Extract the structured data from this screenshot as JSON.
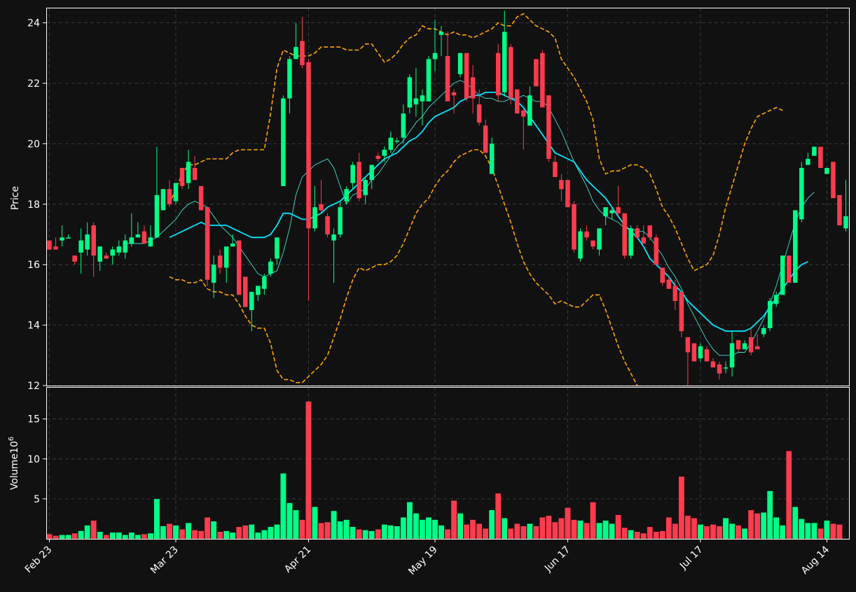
{
  "chart_data": {
    "type": "candlestick",
    "price_panel": {
      "ylabel": "Price",
      "ylim": [
        12,
        24.5
      ],
      "yticks": [
        12,
        14,
        16,
        18,
        20,
        22,
        24
      ]
    },
    "volume_panel": {
      "ylabel": "Volume",
      "ylabel_exponent": "10",
      "ylabel_exponent_power": "6",
      "ylim": [
        0,
        19
      ],
      "yticks": [
        5,
        10,
        15
      ]
    },
    "x_tick_labels": [
      {
        "label": "Feb 23",
        "index": 0
      },
      {
        "label": "Mar 23",
        "index": 20
      },
      {
        "label": "Apr 21",
        "index": 41
      },
      {
        "label": "May 19",
        "index": 61
      },
      {
        "label": "Jun 17",
        "index": 82
      },
      {
        "label": "Jul 17",
        "index": 103
      },
      {
        "label": "Aug 14",
        "index": 123
      }
    ],
    "grid": true,
    "colors": {
      "background": "#111111",
      "up": "#00ff88",
      "down": "#ff3b4e",
      "ma_fast": "#40e0d0",
      "ma_slow": "#00e5ff",
      "bollinger": "#ffa500",
      "grid": "#444444",
      "axis": "#ffffff"
    },
    "candles": [
      [
        16.8,
        16.8,
        16.5,
        16.5
      ],
      [
        16.6,
        16.9,
        16.5,
        16.5
      ],
      [
        16.8,
        17.3,
        16.6,
        16.9
      ],
      [
        16.9,
        17.0,
        16.9,
        16.9
      ],
      [
        16.3,
        16.3,
        16.0,
        16.1
      ],
      [
        16.4,
        17.2,
        15.7,
        16.8
      ],
      [
        16.5,
        17.4,
        16.3,
        17.0
      ],
      [
        17.3,
        17.4,
        15.6,
        16.3
      ],
      [
        16.1,
        16.6,
        15.8,
        16.6
      ],
      [
        16.3,
        16.4,
        16.3,
        16.2
      ],
      [
        16.3,
        16.6,
        16.0,
        16.5
      ],
      [
        16.4,
        16.8,
        16.3,
        16.6
      ],
      [
        16.4,
        17.0,
        16.2,
        16.8
      ],
      [
        16.7,
        17.7,
        16.6,
        16.9
      ],
      [
        16.9,
        17.4,
        16.9,
        17.0
      ],
      [
        17.1,
        17.3,
        16.7,
        16.7
      ],
      [
        16.6,
        17.3,
        16.6,
        16.9
      ],
      [
        16.9,
        19.9,
        16.9,
        18.3
      ],
      [
        17.8,
        18.5,
        17.8,
        18.5
      ],
      [
        18.5,
        18.8,
        17.9,
        18.0
      ],
      [
        18.1,
        18.7,
        18.0,
        18.7
      ],
      [
        19.2,
        19.2,
        18.5,
        18.6
      ],
      [
        18.7,
        19.8,
        18.5,
        19.4
      ],
      [
        19.2,
        19.6,
        18.8,
        18.8
      ],
      [
        18.6,
        18.6,
        17.8,
        17.8
      ],
      [
        17.9,
        17.9,
        15.3,
        15.5
      ],
      [
        15.4,
        16.3,
        14.9,
        16.0
      ],
      [
        16.3,
        16.5,
        15.7,
        15.9
      ],
      [
        15.9,
        16.6,
        15.4,
        16.6
      ],
      [
        16.6,
        17.0,
        16.6,
        16.7
      ],
      [
        16.8,
        16.8,
        15.1,
        15.0
      ],
      [
        15.6,
        15.6,
        14.6,
        14.6
      ],
      [
        14.5,
        15.1,
        13.8,
        15.1
      ],
      [
        15.0,
        15.3,
        14.8,
        15.3
      ],
      [
        15.2,
        15.7,
        15.0,
        15.6
      ],
      [
        15.7,
        16.2,
        15.6,
        16.1
      ],
      [
        16.2,
        16.9,
        16.0,
        16.9
      ],
      [
        18.6,
        21.6,
        18.6,
        21.5
      ],
      [
        21.5,
        22.9,
        21.0,
        22.8
      ],
      [
        22.8,
        24.0,
        22.8,
        23.2
      ],
      [
        23.4,
        24.2,
        22.5,
        22.6
      ],
      [
        22.7,
        22.8,
        14.8,
        17.2
      ],
      [
        17.2,
        18.6,
        17.1,
        17.9
      ],
      [
        18.0,
        18.8,
        17.7,
        17.8
      ],
      [
        17.6,
        17.7,
        16.9,
        17.0
      ],
      [
        16.8,
        17.2,
        15.4,
        17.0
      ],
      [
        17.0,
        18.1,
        16.9,
        17.9
      ],
      [
        18.1,
        18.6,
        18.0,
        18.5
      ],
      [
        18.7,
        19.4,
        18.5,
        19.3
      ],
      [
        19.4,
        19.7,
        18.1,
        18.2
      ],
      [
        18.3,
        18.9,
        18.0,
        18.8
      ],
      [
        18.8,
        19.3,
        18.5,
        19.3
      ],
      [
        19.6,
        19.7,
        19.4,
        19.5
      ],
      [
        19.6,
        19.9,
        19.4,
        19.8
      ],
      [
        19.8,
        20.4,
        19.7,
        20.2
      ],
      [
        20.1,
        20.2,
        20.0,
        20.1
      ],
      [
        20.2,
        21.3,
        20.0,
        21.0
      ],
      [
        21.2,
        22.3,
        21.0,
        22.2
      ],
      [
        21.3,
        22.5,
        20.9,
        21.5
      ],
      [
        21.4,
        21.8,
        20.6,
        21.6
      ],
      [
        21.4,
        22.9,
        21.4,
        22.8
      ],
      [
        22.8,
        24.1,
        22.4,
        23.0
      ],
      [
        23.6,
        23.9,
        22.9,
        23.7
      ],
      [
        22.9,
        23.7,
        22.5,
        21.4
      ],
      [
        21.7,
        21.8,
        21.0,
        21.6
      ],
      [
        22.3,
        23.0,
        22.2,
        23.0
      ],
      [
        23.0,
        23.0,
        21.4,
        21.5
      ],
      [
        22.2,
        22.6,
        21.0,
        21.5
      ],
      [
        21.3,
        21.8,
        20.6,
        20.7
      ],
      [
        20.6,
        20.8,
        19.8,
        19.7
      ],
      [
        19.0,
        20.2,
        19.0,
        20.0
      ],
      [
        23.0,
        23.3,
        21.4,
        21.6
      ],
      [
        21.7,
        24.4,
        21.6,
        23.7
      ],
      [
        23.2,
        23.3,
        21.3,
        21.5
      ],
      [
        21.8,
        21.8,
        21.0,
        21.0
      ],
      [
        21.1,
        21.2,
        19.8,
        20.9
      ],
      [
        20.6,
        21.9,
        20.6,
        21.6
      ],
      [
        22.8,
        22.8,
        21.9,
        21.9
      ],
      [
        23.0,
        23.1,
        21.3,
        21.2
      ],
      [
        21.6,
        21.6,
        19.4,
        19.5
      ],
      [
        19.4,
        19.6,
        18.9,
        18.9
      ],
      [
        18.8,
        19.0,
        18.1,
        18.5
      ],
      [
        18.8,
        18.8,
        17.9,
        17.9
      ],
      [
        18.0,
        18.1,
        16.4,
        16.5
      ],
      [
        16.2,
        17.2,
        16.1,
        17.1
      ],
      [
        17.1,
        17.3,
        16.8,
        16.9
      ],
      [
        16.8,
        16.8,
        16.5,
        16.6
      ],
      [
        16.5,
        17.2,
        16.3,
        17.2
      ],
      [
        17.6,
        17.8,
        17.3,
        17.9
      ],
      [
        17.7,
        17.9,
        17.5,
        17.8
      ],
      [
        17.9,
        18.6,
        17.6,
        17.7
      ],
      [
        17.7,
        17.7,
        16.2,
        16.3
      ],
      [
        16.3,
        17.3,
        16.2,
        17.2
      ],
      [
        17.2,
        17.3,
        16.9,
        16.9
      ],
      [
        16.9,
        17.3,
        16.7,
        16.7
      ],
      [
        17.3,
        17.3,
        16.8,
        16.9
      ],
      [
        16.9,
        17.0,
        16.0,
        16.0
      ],
      [
        15.9,
        15.9,
        15.3,
        15.4
      ],
      [
        15.5,
        15.6,
        15.2,
        15.2
      ],
      [
        15.3,
        15.5,
        14.5,
        14.8
      ],
      [
        15.1,
        15.1,
        13.6,
        13.8
      ],
      [
        13.6,
        13.6,
        12.0,
        13.1
      ],
      [
        13.4,
        13.4,
        12.8,
        12.8
      ],
      [
        12.9,
        13.4,
        12.8,
        13.3
      ],
      [
        13.2,
        13.3,
        12.8,
        12.8
      ],
      [
        12.8,
        12.9,
        12.6,
        12.6
      ],
      [
        12.7,
        12.8,
        12.2,
        12.4
      ],
      [
        12.6,
        12.8,
        12.4,
        12.6
      ],
      [
        12.6,
        13.8,
        12.3,
        13.4
      ],
      [
        13.5,
        13.5,
        13.1,
        13.2
      ],
      [
        13.2,
        13.5,
        13.2,
        13.4
      ],
      [
        13.6,
        13.9,
        13.0,
        13.1
      ],
      [
        13.3,
        13.7,
        13.2,
        13.2
      ],
      [
        13.7,
        14.0,
        13.6,
        13.9
      ],
      [
        13.9,
        14.9,
        13.8,
        14.8
      ],
      [
        14.7,
        15.1,
        14.6,
        15.0
      ],
      [
        15.0,
        16.3,
        15.0,
        16.3
      ],
      [
        16.3,
        16.3,
        15.4,
        15.4
      ],
      [
        15.4,
        17.8,
        15.4,
        17.8
      ],
      [
        17.5,
        19.4,
        17.4,
        19.2
      ],
      [
        19.3,
        19.7,
        19.3,
        19.5
      ],
      [
        19.6,
        19.9,
        19.6,
        19.9
      ],
      [
        19.9,
        19.9,
        19.2,
        19.2
      ],
      [
        19.0,
        19.2,
        19.0,
        19.2
      ],
      [
        19.4,
        19.4,
        18.2,
        18.2
      ],
      [
        18.3,
        18.3,
        17.3,
        17.3
      ],
      [
        17.2,
        18.8,
        17.1,
        17.6
      ]
    ],
    "volume_millions": [
      0.6,
      0.4,
      0.5,
      0.5,
      0.7,
      1.0,
      1.7,
      2.3,
      0.9,
      0.5,
      0.8,
      0.8,
      0.5,
      0.8,
      0.5,
      0.6,
      0.7,
      5.0,
      1.6,
      1.9,
      1.7,
      1.2,
      2.0,
      1.1,
      1.0,
      2.7,
      2.2,
      0.9,
      1.0,
      0.8,
      1.5,
      1.7,
      1.8,
      0.8,
      1.1,
      1.5,
      1.8,
      8.2,
      4.5,
      3.6,
      2.4,
      17.2,
      4.0,
      2.0,
      2.1,
      3.5,
      2.2,
      2.4,
      1.5,
      1.2,
      1.1,
      1.0,
      1.2,
      1.8,
      1.7,
      1.6,
      2.7,
      4.6,
      3.2,
      2.4,
      2.7,
      2.4,
      1.7,
      1.2,
      4.8,
      3.2,
      1.8,
      2.4,
      1.9,
      1.3,
      3.6,
      5.7,
      2.6,
      1.3,
      1.9,
      1.6,
      1.9,
      1.6,
      2.7,
      2.9,
      2.1,
      2.6,
      3.9,
      2.4,
      2.3,
      2.0,
      4.6,
      2.0,
      2.3,
      1.9,
      3.0,
      1.4,
      1.1,
      0.9,
      0.7,
      1.5,
      0.9,
      1.0,
      2.7,
      1.9,
      7.8,
      2.9,
      2.6,
      1.8,
      1.6,
      1.8,
      1.6,
      2.6,
      1.9,
      1.7,
      1.3,
      3.6,
      3.2,
      3.3,
      6.0,
      2.7,
      1.7,
      11.0,
      4.0,
      2.5,
      2.0,
      2.0,
      1.3,
      2.3,
      1.9,
      1.8
    ],
    "ma_fast": [
      null,
      null,
      null,
      null,
      null,
      null,
      null,
      null,
      null,
      null,
      null,
      null,
      16.7,
      16.7,
      16.7,
      16.7,
      16.8,
      16.9,
      17.1,
      17.3,
      17.5,
      17.8,
      18.0,
      18.1,
      18.0,
      17.9,
      17.6,
      17.3,
      17.1,
      16.9,
      16.6,
      16.3,
      16.0,
      15.7,
      15.6,
      15.7,
      15.8,
      16.4,
      17.2,
      18.3,
      18.9,
      19.1,
      19.3,
      19.4,
      19.5,
      19.2,
      18.6,
      18.0,
      18.3,
      18.4,
      18.5,
      18.8,
      19.0,
      19.3,
      19.6,
      19.9,
      20.1,
      20.4,
      20.7,
      20.9,
      21.2,
      21.4,
      21.6,
      21.8,
      22.0,
      22.1,
      22.0,
      21.8,
      21.6,
      21.5,
      21.5,
      21.4,
      21.4,
      21.5,
      21.5,
      21.6,
      21.5,
      21.4,
      21.4,
      21.2,
      20.8,
      20.4,
      19.9,
      19.4,
      19.0,
      18.6,
      18.1,
      17.8,
      17.6,
      17.5,
      17.4,
      17.2,
      17.2,
      17.1,
      17.1,
      16.9,
      16.6,
      16.3,
      15.9,
      15.6,
      15.2,
      14.7,
      14.3,
      13.9,
      13.5,
      13.2,
      13.0,
      13.0,
      13.0,
      13.1,
      13.1,
      13.4,
      13.8,
      14.2,
      14.7,
      15.3,
      16.0,
      16.7,
      17.4,
      17.9,
      18.2,
      18.4
    ],
    "ma_slow": [
      null,
      null,
      null,
      null,
      null,
      null,
      null,
      null,
      null,
      null,
      null,
      null,
      null,
      null,
      null,
      null,
      null,
      null,
      null,
      16.9,
      17.0,
      17.1,
      17.2,
      17.3,
      17.4,
      17.3,
      17.3,
      17.3,
      17.3,
      17.2,
      17.1,
      17.0,
      16.9,
      16.9,
      16.9,
      17.0,
      17.3,
      17.7,
      17.7,
      17.6,
      17.5,
      17.5,
      17.6,
      17.7,
      17.9,
      18.0,
      18.1,
      18.3,
      18.5,
      18.7,
      18.9,
      19.1,
      19.3,
      19.5,
      19.6,
      19.7,
      19.9,
      20.1,
      20.2,
      20.4,
      20.7,
      20.9,
      21.0,
      21.1,
      21.2,
      21.4,
      21.5,
      21.6,
      21.6,
      21.7,
      21.7,
      21.7,
      21.6,
      21.5,
      21.4,
      21.2,
      20.9,
      20.6,
      20.3,
      20.0,
      19.7,
      19.6,
      19.5,
      19.4,
      19.1,
      18.8,
      18.6,
      18.4,
      18.2,
      17.9,
      17.6,
      17.3,
      17.1,
      16.9,
      16.6,
      16.2,
      16.0,
      15.8,
      15.6,
      15.3,
      15.1,
      14.8,
      14.6,
      14.4,
      14.2,
      14.0,
      13.9,
      13.8,
      13.8,
      13.8,
      13.8,
      13.9,
      14.1,
      14.3,
      14.6,
      14.9,
      15.2,
      15.5,
      15.8,
      16.0,
      16.1
    ],
    "bb_upper": [
      null,
      null,
      null,
      null,
      null,
      null,
      null,
      null,
      null,
      null,
      null,
      null,
      null,
      null,
      null,
      null,
      null,
      null,
      null,
      18.0,
      18.5,
      19.0,
      19.3,
      19.3,
      19.4,
      19.5,
      19.5,
      19.5,
      19.5,
      19.7,
      19.8,
      19.8,
      19.8,
      19.8,
      19.8,
      21.0,
      22.5,
      23.1,
      23.0,
      22.9,
      22.9,
      22.9,
      23.0,
      23.2,
      23.2,
      23.2,
      23.2,
      23.1,
      23.1,
      23.1,
      23.3,
      23.3,
      23.0,
      22.7,
      22.8,
      23.0,
      23.3,
      23.5,
      23.6,
      23.9,
      23.8,
      23.8,
      23.7,
      23.6,
      23.7,
      23.6,
      23.6,
      23.5,
      23.6,
      23.7,
      23.8,
      24.0,
      23.9,
      23.9,
      24.2,
      24.3,
      24.1,
      23.9,
      23.8,
      23.7,
      23.5,
      22.8,
      22.5,
      22.2,
      21.8,
      21.4,
      20.8,
      19.5,
      19.0,
      19.1,
      19.1,
      19.2,
      19.3,
      19.3,
      19.2,
      19.0,
      18.5,
      17.9,
      17.6,
      17.2,
      16.7,
      16.2,
      15.8,
      15.9,
      16.0,
      16.3,
      17.0,
      17.9,
      18.6,
      19.3,
      20.0,
      20.5,
      20.9,
      21.0,
      21.1,
      21.2,
      21.1
    ],
    "bb_lower": [
      null,
      null,
      null,
      null,
      null,
      null,
      null,
      null,
      null,
      null,
      null,
      null,
      null,
      null,
      null,
      null,
      null,
      null,
      null,
      15.6,
      15.5,
      15.5,
      15.4,
      15.4,
      15.5,
      15.2,
      15.1,
      15.1,
      15.0,
      15.0,
      14.7,
      14.3,
      14.0,
      13.9,
      13.9,
      13.4,
      12.5,
      12.2,
      12.2,
      12.1,
      12.1,
      12.3,
      12.5,
      12.7,
      13.0,
      13.6,
      14.2,
      14.9,
      15.5,
      15.9,
      15.8,
      15.9,
      16.0,
      16.0,
      16.1,
      16.3,
      16.7,
      17.2,
      17.7,
      18.0,
      18.2,
      18.6,
      18.9,
      19.1,
      19.4,
      19.6,
      19.7,
      19.8,
      19.8,
      19.6,
      19.2,
      18.6,
      18.0,
      17.4,
      16.7,
      16.1,
      15.7,
      15.4,
      15.2,
      15.0,
      14.7,
      14.8,
      14.7,
      14.6,
      14.6,
      14.8,
      15.0,
      15.0,
      14.5,
      13.9,
      13.3,
      12.8,
      12.4,
      12.0,
      11.6,
      11.2
    ]
  }
}
